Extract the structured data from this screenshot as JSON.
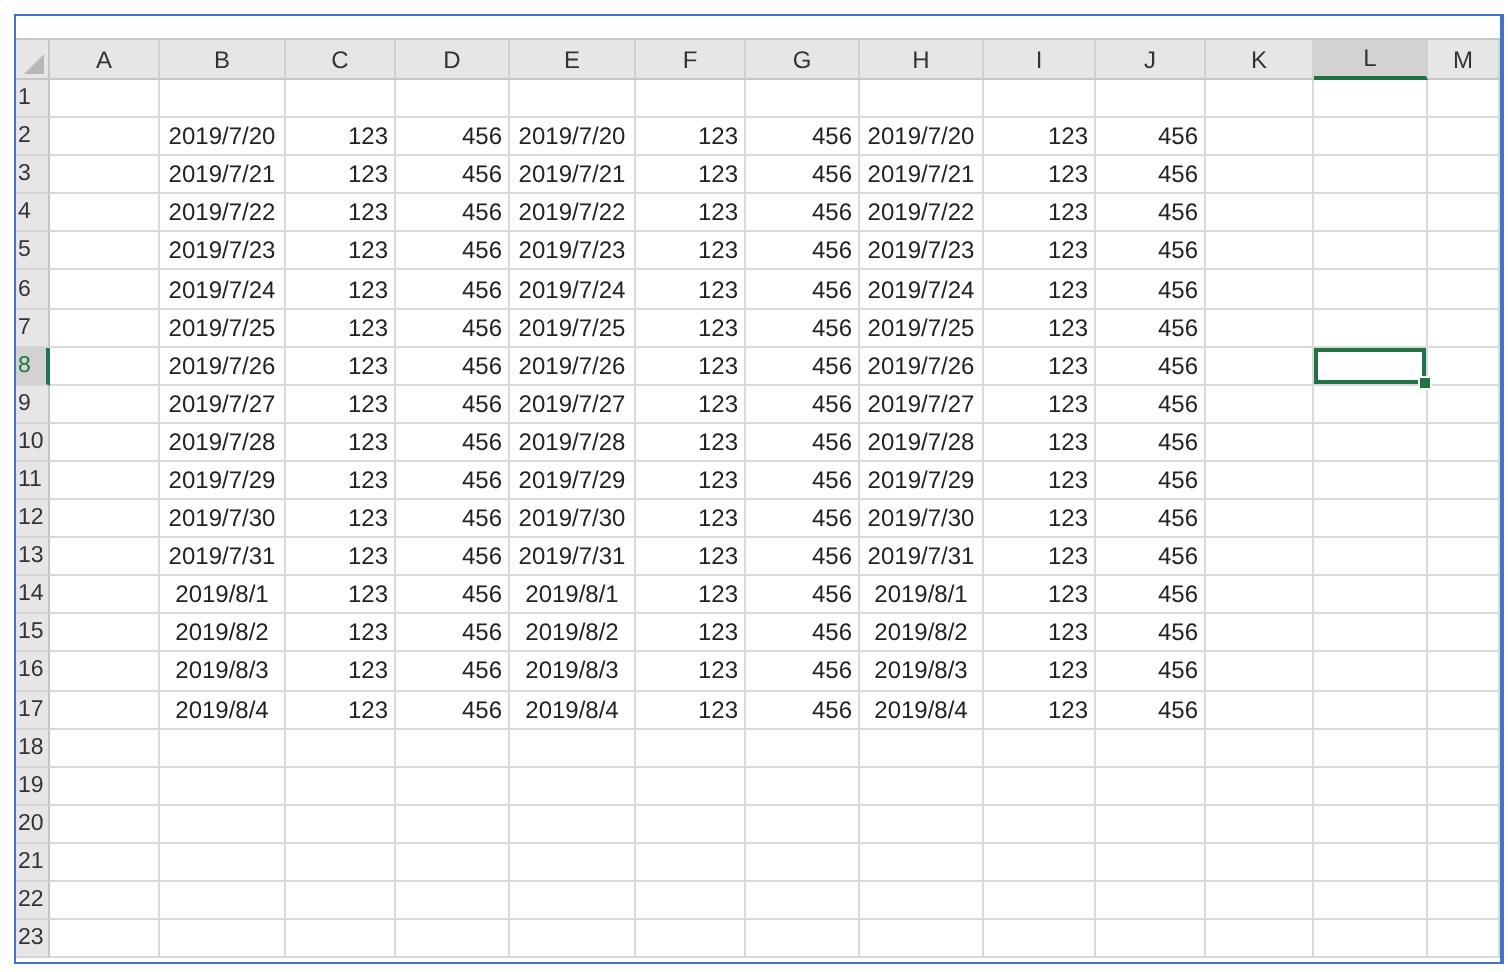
{
  "columns": [
    {
      "label": "A",
      "selected": false
    },
    {
      "label": "B",
      "selected": false,
      "kind": "date"
    },
    {
      "label": "C",
      "selected": false,
      "kind": "number"
    },
    {
      "label": "D",
      "selected": false,
      "kind": "number"
    },
    {
      "label": "E",
      "selected": false,
      "kind": "date"
    },
    {
      "label": "F",
      "selected": false,
      "kind": "number"
    },
    {
      "label": "G",
      "selected": false,
      "kind": "number"
    },
    {
      "label": "H",
      "selected": false,
      "kind": "date"
    },
    {
      "label": "I",
      "selected": false,
      "kind": "number"
    },
    {
      "label": "J",
      "selected": false,
      "kind": "number"
    },
    {
      "label": "K",
      "selected": false
    },
    {
      "label": "L",
      "selected": true
    },
    {
      "label": "M",
      "selected": false
    }
  ],
  "rows": [
    {
      "label": "1",
      "selected": false
    },
    {
      "label": "2",
      "selected": false,
      "cells": [
        "2019/7/20",
        "123",
        "456",
        "2019/7/20",
        "123",
        "456",
        "2019/7/20",
        "123",
        "456"
      ]
    },
    {
      "label": "3",
      "selected": false,
      "cells": [
        "2019/7/21",
        "123",
        "456",
        "2019/7/21",
        "123",
        "456",
        "2019/7/21",
        "123",
        "456"
      ]
    },
    {
      "label": "4",
      "selected": false,
      "cells": [
        "2019/7/22",
        "123",
        "456",
        "2019/7/22",
        "123",
        "456",
        "2019/7/22",
        "123",
        "456"
      ]
    },
    {
      "label": "5",
      "selected": false,
      "cells": [
        "2019/7/23",
        "123",
        "456",
        "2019/7/23",
        "123",
        "456",
        "2019/7/23",
        "123",
        "456"
      ]
    },
    {
      "label": "6",
      "selected": false,
      "cells": [
        "2019/7/24",
        "123",
        "456",
        "2019/7/24",
        "123",
        "456",
        "2019/7/24",
        "123",
        "456"
      ]
    },
    {
      "label": "7",
      "selected": false,
      "cells": [
        "2019/7/25",
        "123",
        "456",
        "2019/7/25",
        "123",
        "456",
        "2019/7/25",
        "123",
        "456"
      ]
    },
    {
      "label": "8",
      "selected": true,
      "cells": [
        "2019/7/26",
        "123",
        "456",
        "2019/7/26",
        "123",
        "456",
        "2019/7/26",
        "123",
        "456"
      ]
    },
    {
      "label": "9",
      "selected": false,
      "cells": [
        "2019/7/27",
        "123",
        "456",
        "2019/7/27",
        "123",
        "456",
        "2019/7/27",
        "123",
        "456"
      ]
    },
    {
      "label": "10",
      "selected": false,
      "cells": [
        "2019/7/28",
        "123",
        "456",
        "2019/7/28",
        "123",
        "456",
        "2019/7/28",
        "123",
        "456"
      ]
    },
    {
      "label": "11",
      "selected": false,
      "cells": [
        "2019/7/29",
        "123",
        "456",
        "2019/7/29",
        "123",
        "456",
        "2019/7/29",
        "123",
        "456"
      ]
    },
    {
      "label": "12",
      "selected": false,
      "cells": [
        "2019/7/30",
        "123",
        "456",
        "2019/7/30",
        "123",
        "456",
        "2019/7/30",
        "123",
        "456"
      ]
    },
    {
      "label": "13",
      "selected": false,
      "cells": [
        "2019/7/31",
        "123",
        "456",
        "2019/7/31",
        "123",
        "456",
        "2019/7/31",
        "123",
        "456"
      ]
    },
    {
      "label": "14",
      "selected": false,
      "cells": [
        "2019/8/1",
        "123",
        "456",
        "2019/8/1",
        "123",
        "456",
        "2019/8/1",
        "123",
        "456"
      ]
    },
    {
      "label": "15",
      "selected": false,
      "cells": [
        "2019/8/2",
        "123",
        "456",
        "2019/8/2",
        "123",
        "456",
        "2019/8/2",
        "123",
        "456"
      ]
    },
    {
      "label": "16",
      "selected": false,
      "cells": [
        "2019/8/3",
        "123",
        "456",
        "2019/8/3",
        "123",
        "456",
        "2019/8/3",
        "123",
        "456"
      ]
    },
    {
      "label": "17",
      "selected": false,
      "cells": [
        "2019/8/4",
        "123",
        "456",
        "2019/8/4",
        "123",
        "456",
        "2019/8/4",
        "123",
        "456"
      ]
    },
    {
      "label": "18",
      "selected": false
    },
    {
      "label": "19",
      "selected": false
    },
    {
      "label": "20",
      "selected": false
    },
    {
      "label": "21",
      "selected": false
    },
    {
      "label": "22",
      "selected": false
    },
    {
      "label": "23",
      "selected": false
    }
  ]
}
